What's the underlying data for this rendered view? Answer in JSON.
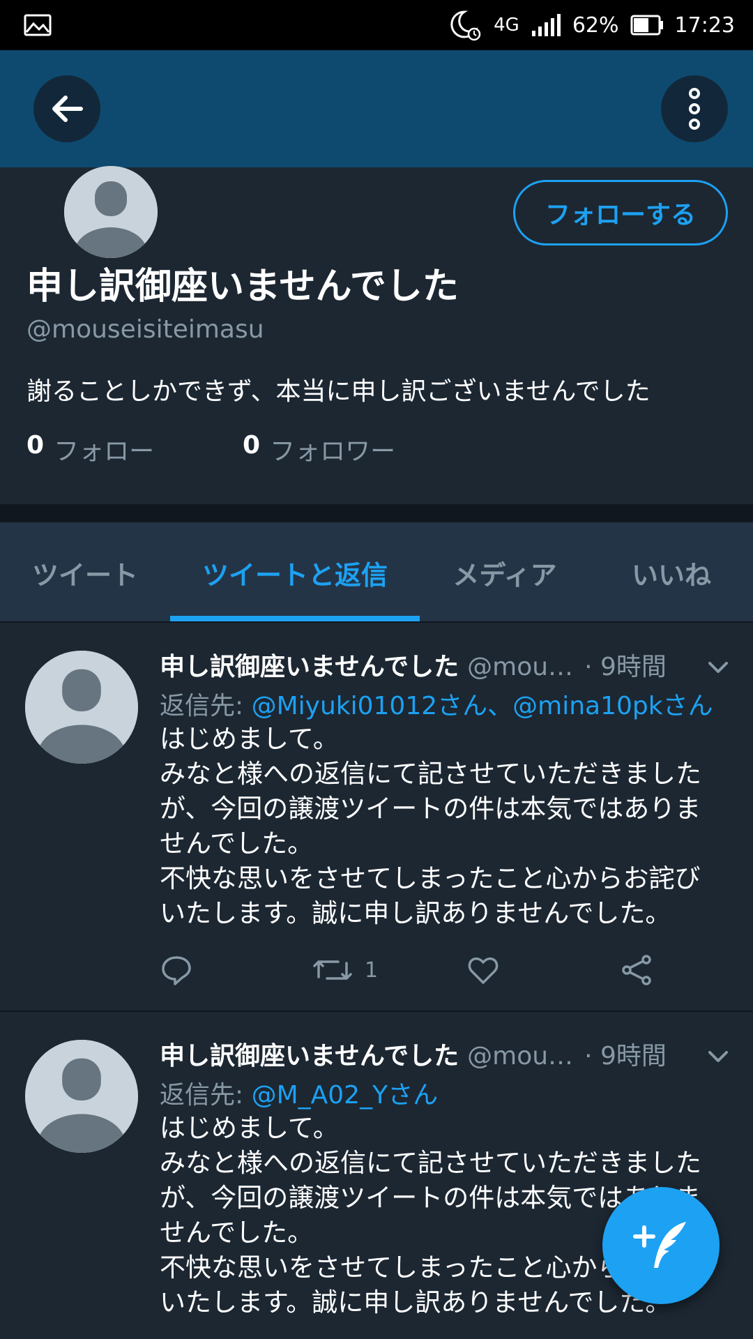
{
  "status_bar": {
    "battery": "62%",
    "time": "17:23",
    "network": "4G",
    "icons": [
      "gallery-icon",
      "do-not-disturb-icon",
      "alarm-icon",
      "signal-icon",
      "battery-icon"
    ]
  },
  "app_bar": {
    "back_icon": "arrow-left-icon",
    "menu_icon": "more-vertical-icon"
  },
  "profile": {
    "name": "申し訳御座いませんでした",
    "handle": "@mouseisiteimasu",
    "bio": "謝ることしかできず、本当に申し訳ございませんでした",
    "follow_button": "フォローする",
    "following_count": "0",
    "following_label": "フォロー",
    "followers_count": "0",
    "followers_label": "フォロワー"
  },
  "tabs": [
    {
      "label": "ツイート",
      "active": false
    },
    {
      "label": "ツイートと返信",
      "active": true
    },
    {
      "label": "メディア",
      "active": false
    },
    {
      "label": "いいね",
      "active": false
    }
  ],
  "tweets": [
    {
      "name": "申し訳御座いませんでした",
      "handle": "@mous...",
      "time": "· 9時間",
      "reply_prefix": "返信先:",
      "reply_to": "@Miyuki01012さん、@mina10pkさん",
      "lines": [
        "はじめまして。",
        "みなと様への返信にて記させていただきました",
        "が、今回の譲渡ツイートの件は本気ではありま",
        "せんでした。",
        "不快な思いをさせてしまったこと心からお詫び",
        "いたします。誠に申し訳ありませんでした。"
      ],
      "retweet_count": "1"
    },
    {
      "name": "申し訳御座いませんでした",
      "handle": "@mous...",
      "time": "· 9時間",
      "reply_prefix": "返信先:",
      "reply_to": "@M_A02_Yさん",
      "lines": [
        "はじめまして。",
        "みなと様への返信にて記させていただきました",
        "が、今回の譲渡ツイートの件は本気ではありま",
        "せんでした。",
        "不快な思いをさせてしまったこと心からお詫び",
        "いたします。誠に申し訳ありませんでした。"
      ]
    }
  ],
  "fab": {
    "icon": "compose-tweet-icon"
  },
  "colors": {
    "background": "#1c2732",
    "app_bar": "#0e4a70",
    "accent": "#1da1f2",
    "secondary_text": "#8899a6",
    "tab_bar": "#243447"
  }
}
